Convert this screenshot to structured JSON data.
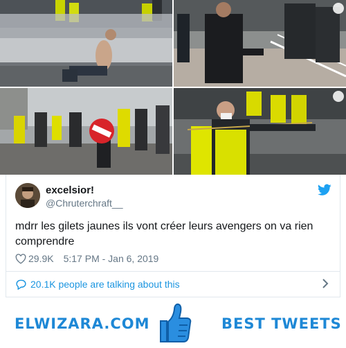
{
  "tweet": {
    "author_name": "excelsior!",
    "author_handle": "@Chruterchraft__",
    "text": "mdrr les gilets jaunes ils vont créer leurs avengers on va rien comprendre",
    "likes": "29.9K",
    "timestamp": "5:17 PM - Jan 6, 2019",
    "conversation": "20.1K people are talking about this"
  },
  "images": [
    {
      "icon": "photo-water-cannon-kneeling-man"
    },
    {
      "icon": "photo-boxer-fight-police"
    },
    {
      "icon": "photo-crowd-no-entry-sign"
    },
    {
      "icon": "photo-slingshot-yellow-vest"
    }
  ],
  "footer": {
    "left_brand": "ELWIZARA.COM",
    "right_brand": "BEST TWEETS"
  },
  "colors": {
    "accent": "#1da1f2",
    "link": "#1b95e0",
    "brand": "#1e88d6",
    "vest": "#e8e100"
  }
}
